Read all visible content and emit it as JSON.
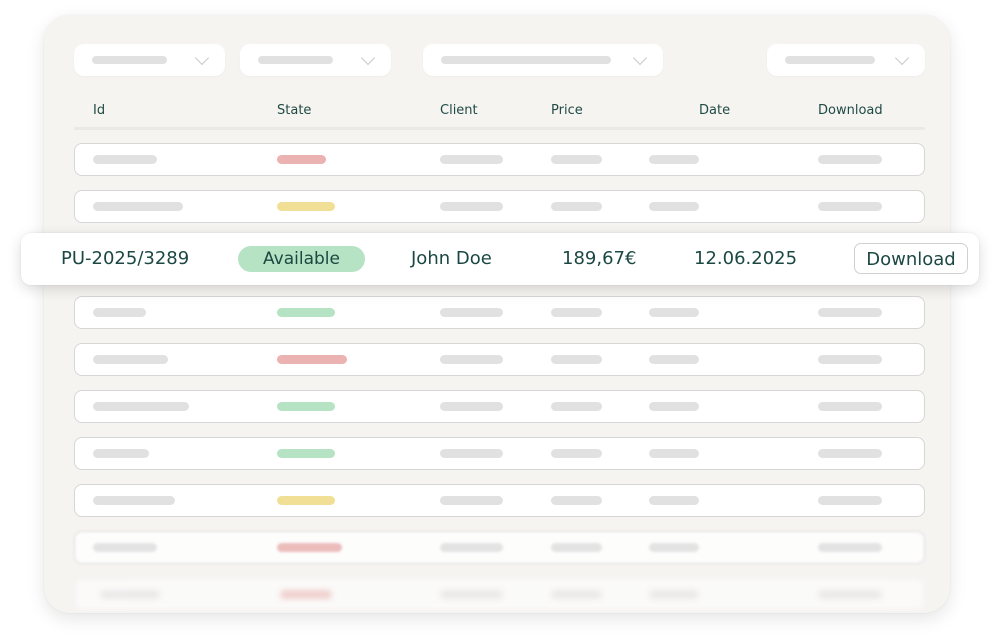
{
  "table": {
    "columns": [
      "Id",
      "State",
      "Client",
      "Price",
      "Date",
      "Download"
    ]
  },
  "highlight_row": {
    "id": "PU-2025/3289",
    "state": "Available",
    "client": "John Doe",
    "price": "189,67€",
    "date": "12.06.2025",
    "download_label": "Download"
  },
  "colors": {
    "accent_text": "#1c4843",
    "status_available": "#b6e3c3",
    "status_red": "#eab3b1",
    "status_yellow": "#f1df96",
    "card_background": "#f6f4f1"
  },
  "placeholder_row_states": [
    "red",
    "yellow",
    "green",
    "red",
    "green",
    "green",
    "yellow",
    "red",
    "red"
  ]
}
